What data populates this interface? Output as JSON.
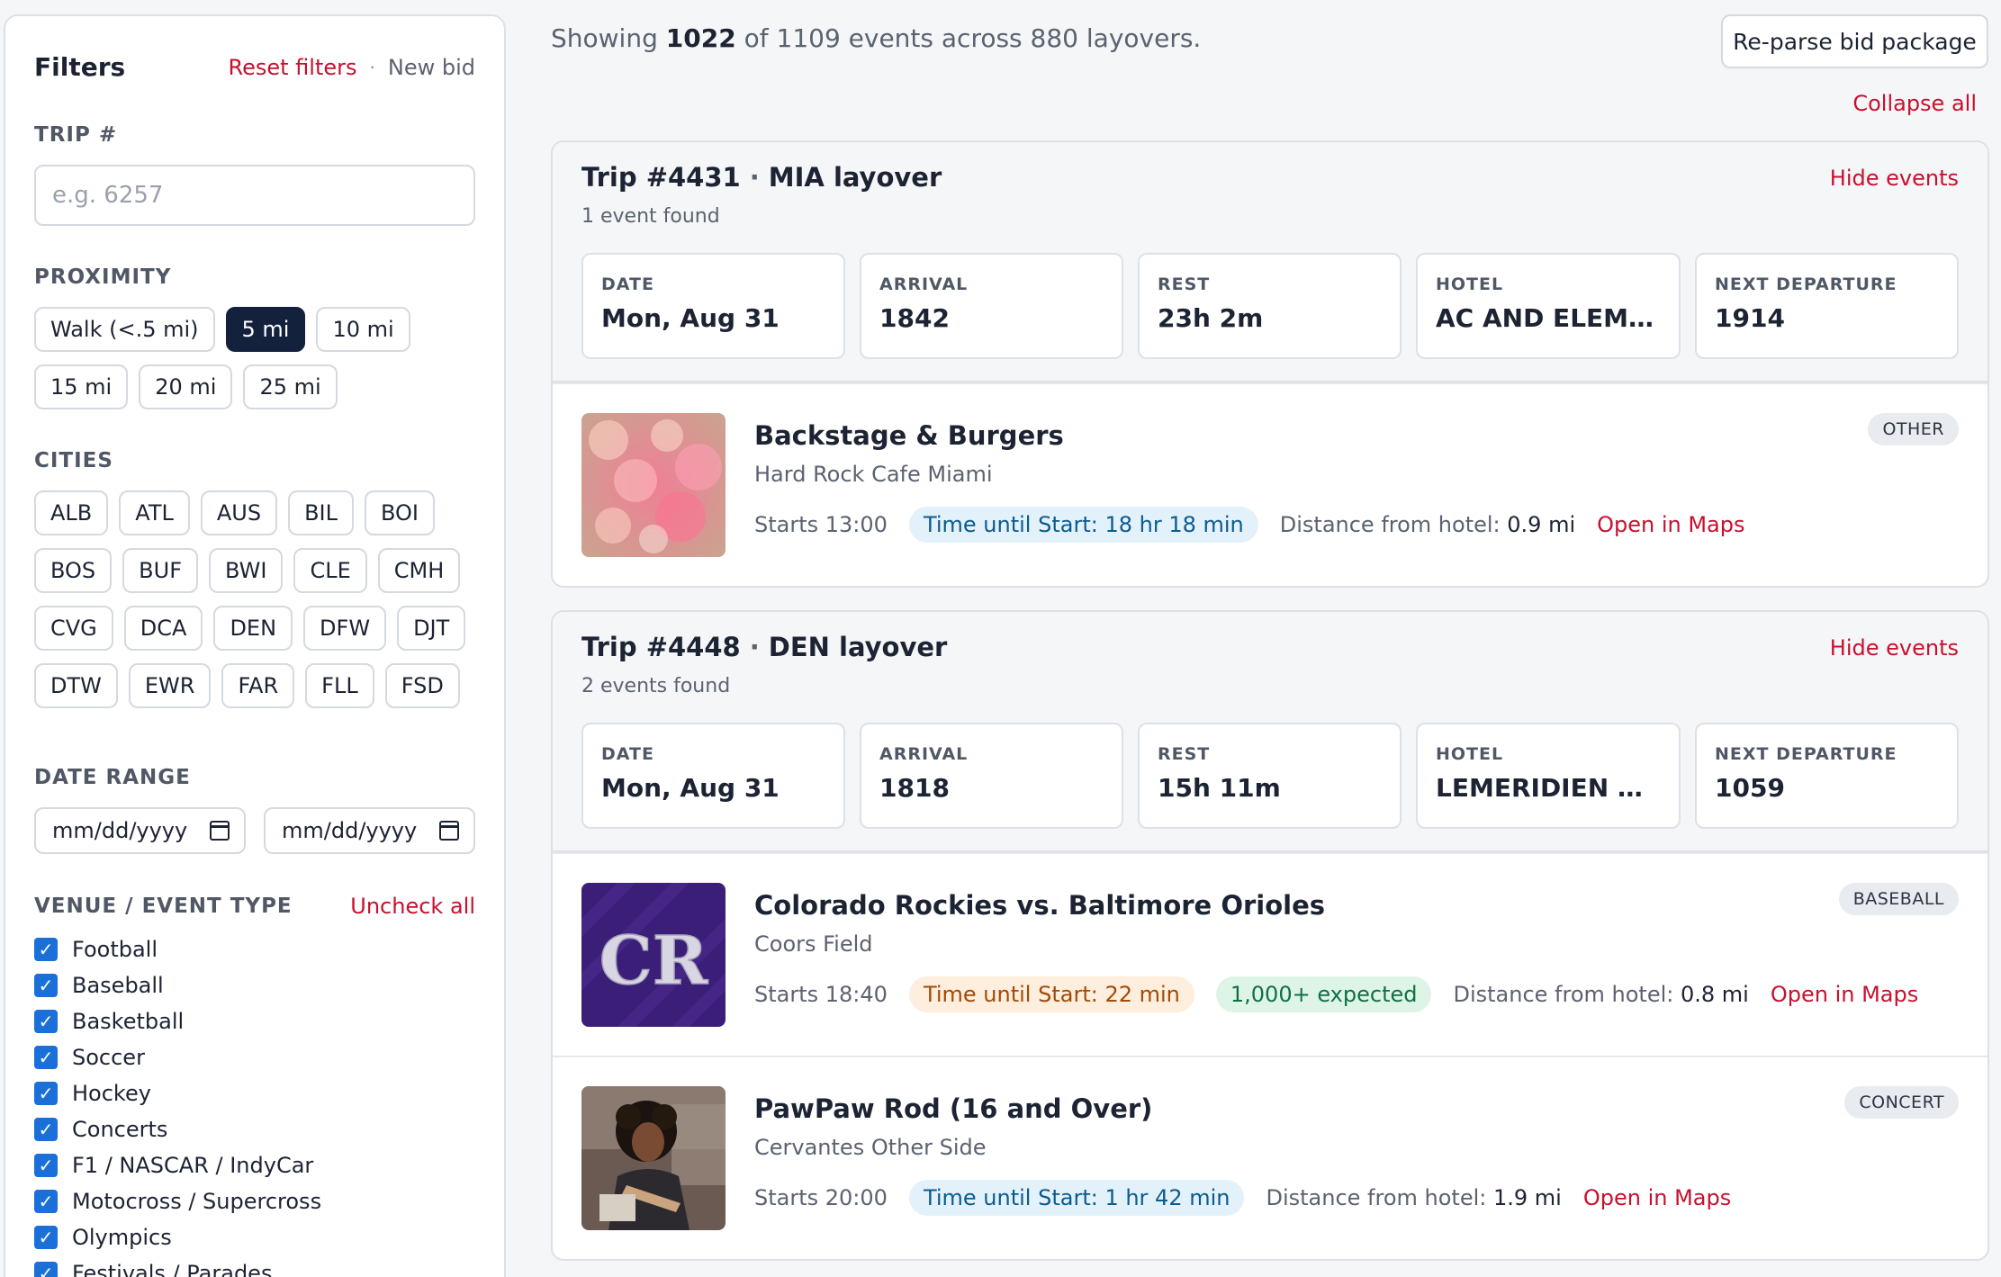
{
  "filters": {
    "title": "Filters",
    "reset_label": "Reset filters",
    "separator": "·",
    "new_bid_label": "New bid",
    "trip": {
      "label": "TRIP #",
      "placeholder": "e.g. 6257",
      "value": ""
    },
    "proximity": {
      "label": "PROXIMITY",
      "options": [
        "Walk (<.5 mi)",
        "5 mi",
        "10 mi",
        "15 mi",
        "20 mi",
        "25 mi"
      ],
      "selected": "5 mi"
    },
    "cities": {
      "label": "CITIES",
      "items": [
        "ALB",
        "ATL",
        "AUS",
        "BIL",
        "BOI",
        "BOS",
        "BUF",
        "BWI",
        "CLE",
        "CMH",
        "CVG",
        "DCA",
        "DEN",
        "DFW",
        "DJT",
        "DTW",
        "EWR",
        "FAR",
        "FLL",
        "FSD"
      ]
    },
    "date_range": {
      "label": "DATE RANGE",
      "start_placeholder": "mm/dd/yyyy",
      "end_placeholder": "mm/dd/yyyy"
    },
    "venue_type": {
      "label": "VENUE / EVENT TYPE",
      "uncheck_label": "Uncheck all",
      "items": [
        {
          "label": "Football",
          "checked": true
        },
        {
          "label": "Baseball",
          "checked": true
        },
        {
          "label": "Basketball",
          "checked": true
        },
        {
          "label": "Soccer",
          "checked": true
        },
        {
          "label": "Hockey",
          "checked": true
        },
        {
          "label": "Concerts",
          "checked": true
        },
        {
          "label": "F1 / NASCAR / IndyCar",
          "checked": true
        },
        {
          "label": "Motocross / Supercross",
          "checked": true
        },
        {
          "label": "Olympics",
          "checked": true
        },
        {
          "label": "Festivals / Parades",
          "checked": true
        }
      ]
    }
  },
  "main": {
    "summary": {
      "prefix": "Showing",
      "shown": "1022",
      "middle": "of 1109 events across 880 layovers."
    },
    "reparse_label": "Re-parse bid package",
    "collapse_all_label": "Collapse all",
    "trips": [
      {
        "trip_no": "Trip #4431",
        "layover": "MIA layover",
        "found": "1 event found",
        "hide_label": "Hide events",
        "stats": [
          {
            "label": "DATE",
            "value": "Mon, Aug 31"
          },
          {
            "label": "ARRIVAL",
            "value": "1842"
          },
          {
            "label": "REST",
            "value": "23h 2m"
          },
          {
            "label": "HOTEL",
            "value": "AC AND ELEMEN..."
          },
          {
            "label": "NEXT DEPARTURE",
            "value": "1914"
          }
        ],
        "events": [
          {
            "title": "Backstage & Burgers",
            "venue": "Hard Rock Cafe Miami",
            "starts": "Starts 13:00",
            "time_until": "Time until Start: 18 hr 18 min",
            "time_color": "blue",
            "expected": "",
            "distance_label": "Distance from hotel:",
            "distance_value": "0.9 mi",
            "maps_label": "Open in Maps",
            "type": "OTHER",
            "thumb": "bokeh"
          }
        ]
      },
      {
        "trip_no": "Trip #4448",
        "layover": "DEN layover",
        "found": "2 events found",
        "hide_label": "Hide events",
        "stats": [
          {
            "label": "DATE",
            "value": "Mon, Aug 31"
          },
          {
            "label": "ARRIVAL",
            "value": "1818"
          },
          {
            "label": "REST",
            "value": "15h 11m"
          },
          {
            "label": "HOTEL",
            "value": "LEMERIDIEN AC ..."
          },
          {
            "label": "NEXT DEPARTURE",
            "value": "1059"
          }
        ],
        "events": [
          {
            "title": "Colorado Rockies vs. Baltimore Orioles",
            "venue": "Coors Field",
            "starts": "Starts 18:40",
            "time_until": "Time until Start: 22 min",
            "time_color": "orange",
            "expected": "1,000+ expected",
            "distance_label": "Distance from hotel:",
            "distance_value": "0.8 mi",
            "maps_label": "Open in Maps",
            "type": "BASEBALL",
            "thumb": "rockies",
            "thumb_text": "CR"
          },
          {
            "title": "PawPaw Rod (16 and Over)",
            "venue": "Cervantes Other Side",
            "starts": "Starts 20:00",
            "time_until": "Time until Start: 1 hr 42 min",
            "time_color": "blue",
            "expected": "",
            "distance_label": "Distance from hotel:",
            "distance_value": "1.9 mi",
            "maps_label": "Open in Maps",
            "type": "CONCERT",
            "thumb": "portrait"
          }
        ]
      }
    ]
  }
}
